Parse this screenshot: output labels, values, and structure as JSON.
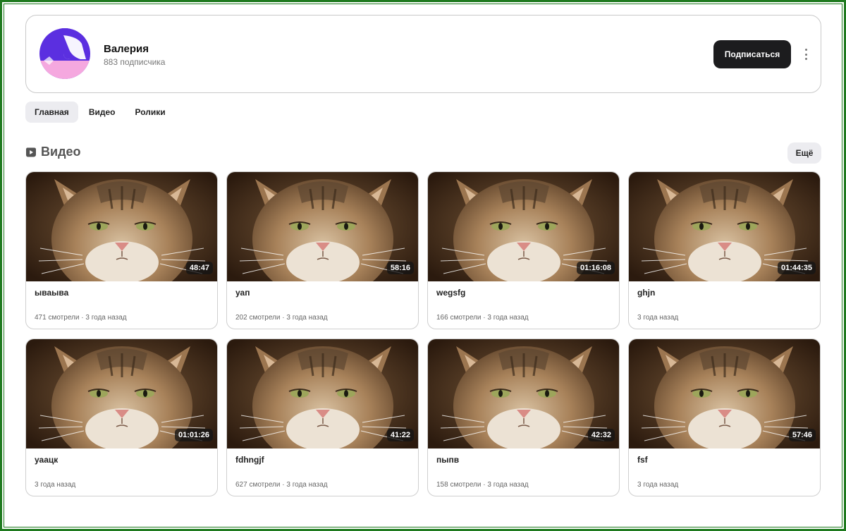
{
  "channel": {
    "name": "Валерия",
    "subscribers": "883 подписчика",
    "subscribe_label": "Подписаться",
    "avatar_colors": {
      "top": "#5b2fe0",
      "bottom": "#f5a8df"
    }
  },
  "tabs": [
    {
      "label": "Главная",
      "active": true
    },
    {
      "label": "Видео",
      "active": false
    },
    {
      "label": "Ролики",
      "active": false
    }
  ],
  "section": {
    "icon": "video-icon",
    "title": "Видео",
    "more_label": "Ещё"
  },
  "videos": [
    {
      "title": "ываыва",
      "meta": "471 смотрели · 3 года назад",
      "duration": "48:47"
    },
    {
      "title": "уап",
      "meta": "202 смотрели · 3 года назад",
      "duration": "58:16"
    },
    {
      "title": "wegsfg",
      "meta": "166 смотрели · 3 года назад",
      "duration": "01:16:08"
    },
    {
      "title": "ghjn",
      "meta": "3 года назад",
      "duration": "01:44:35"
    },
    {
      "title": "уаацк",
      "meta": "3 года назад",
      "duration": "01:01:26"
    },
    {
      "title": "fdhngjf",
      "meta": "627 смотрели · 3 года назад",
      "duration": "41:22"
    },
    {
      "title": "пыпв",
      "meta": "158 смотрели · 3 года назад",
      "duration": "42:32"
    },
    {
      "title": "fsf",
      "meta": "3 года назад",
      "duration": "57:46"
    }
  ],
  "colors": {
    "frame": "#1f7a1f",
    "button": "#1c1c1e",
    "chip": "#ececf0"
  }
}
